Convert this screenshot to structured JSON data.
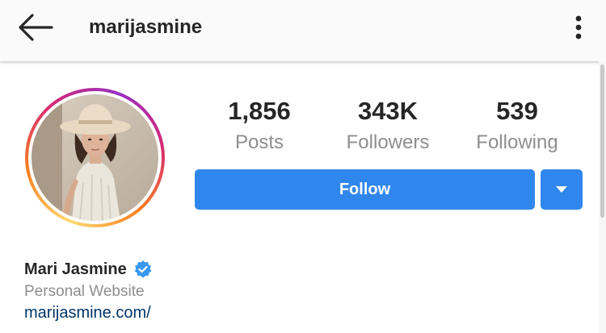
{
  "header": {
    "username": "marijasmine",
    "back_icon": "arrow-left-icon",
    "more_icon": "vertical-dots-icon"
  },
  "profile": {
    "display_name": "Mari Jasmine",
    "verified_icon": "verified-badge-icon",
    "category": "Personal Website",
    "website": "marijasmine.com/"
  },
  "stats": [
    {
      "value": "1,856",
      "label": "Posts"
    },
    {
      "value": "343K",
      "label": "Followers"
    },
    {
      "value": "539",
      "label": "Following"
    }
  ],
  "actions": {
    "follow_label": "Follow",
    "dropdown_icon": "caret-down-icon"
  },
  "colors": {
    "accent": "#2f86ec",
    "link": "#003569",
    "secondary_text": "#8e8e8e"
  }
}
